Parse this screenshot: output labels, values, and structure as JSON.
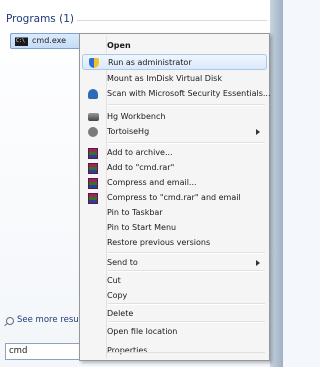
{
  "programs": {
    "header": "Programs (1)",
    "result_label": "cmd.exe",
    "result_icon_text": "C:\\"
  },
  "see_more": {
    "label": "See more results"
  },
  "search": {
    "value": "cmd"
  },
  "menu": {
    "open": "Open",
    "run_as_admin": "Run as administrator",
    "mount": "Mount as ImDisk Virtual Disk",
    "scan": "Scan with Microsoft Security Essentials...",
    "hg_workbench": "Hg Workbench",
    "tortoisehg": "TortoiseHg",
    "add_archive": "Add to archive...",
    "add_rar": "Add to \"cmd.rar\"",
    "compress_email": "Compress and email...",
    "compress_rar_email": "Compress to \"cmd.rar\" and email",
    "pin_taskbar": "Pin to Taskbar",
    "pin_start": "Pin to Start Menu",
    "restore": "Restore previous versions",
    "send_to": "Send to",
    "cut": "Cut",
    "copy": "Copy",
    "delete": "Delete",
    "open_location": "Open file location",
    "properties": "Properties"
  },
  "colors": {
    "header_text": "#1e3a78",
    "hover_fill": "#dbe9fa",
    "hover_border": "#a8c8ec"
  }
}
